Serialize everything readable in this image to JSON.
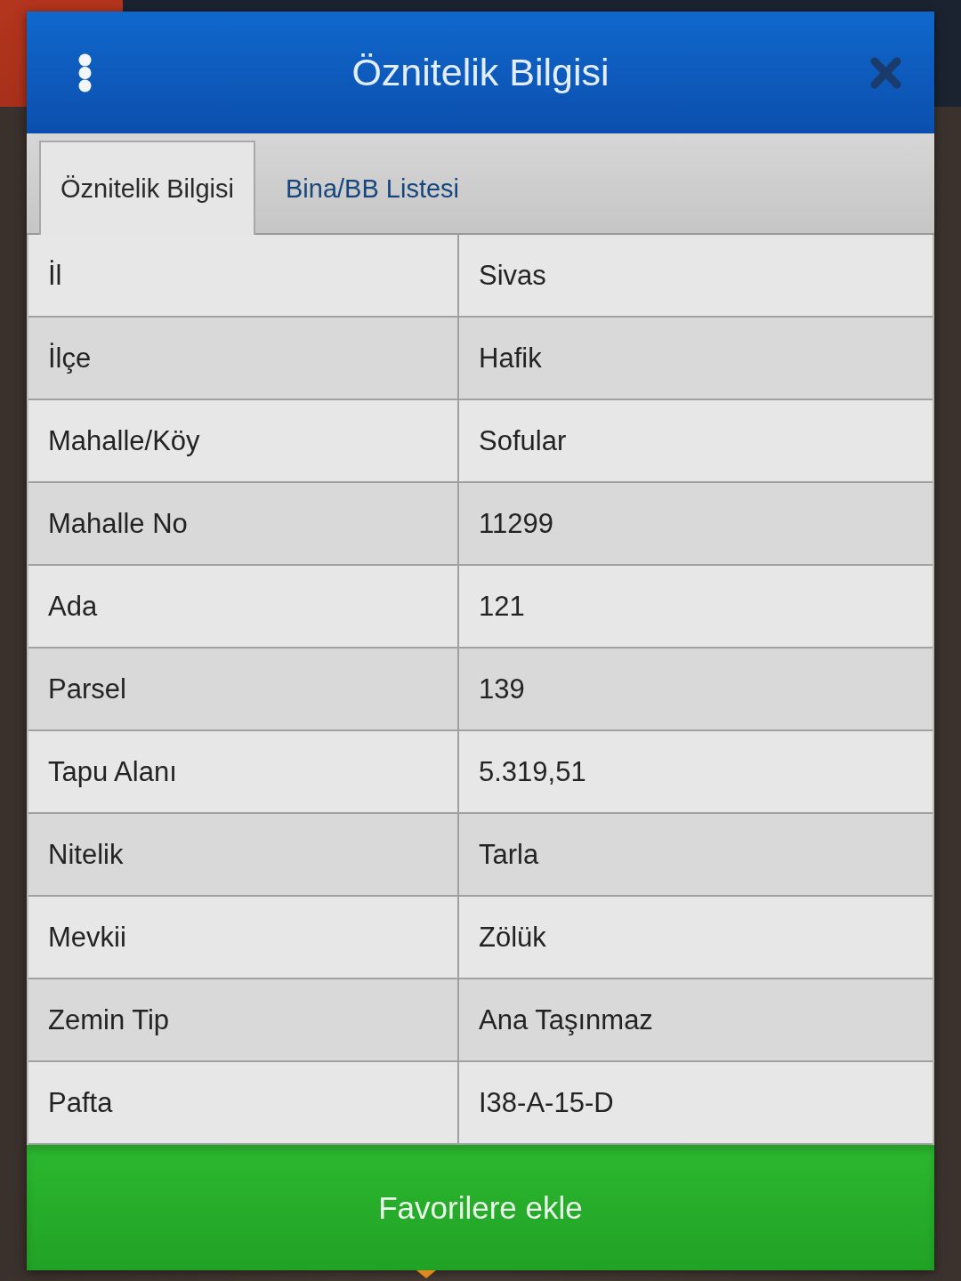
{
  "header": {
    "title": "Öznitelik Bilgisi"
  },
  "tabs": [
    {
      "label": "Öznitelik Bilgisi",
      "selected": true
    },
    {
      "label": "Bina/BB Listesi",
      "selected": false
    }
  ],
  "attributes": [
    {
      "label": "İl",
      "value": "Sivas"
    },
    {
      "label": "İlçe",
      "value": "Hafik"
    },
    {
      "label": "Mahalle/Köy",
      "value": "Sofular"
    },
    {
      "label": "Mahalle No",
      "value": "11299"
    },
    {
      "label": "Ada",
      "value": "121"
    },
    {
      "label": "Parsel",
      "value": "139"
    },
    {
      "label": "Tapu Alanı",
      "value": "5.319,51"
    },
    {
      "label": "Nitelik",
      "value": "Tarla"
    },
    {
      "label": "Mevkii",
      "value": "Zölük"
    },
    {
      "label": "Zemin Tip",
      "value": "Ana Taşınmaz"
    },
    {
      "label": "Pafta",
      "value": "I38-A-15-D"
    }
  ],
  "button": {
    "label": "Favorilere ekle"
  }
}
